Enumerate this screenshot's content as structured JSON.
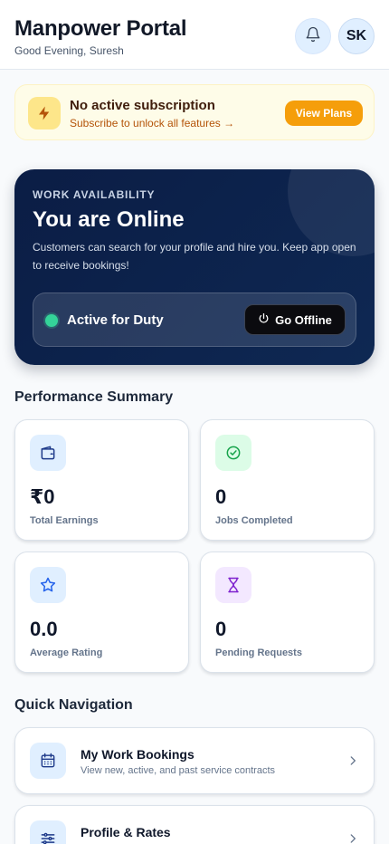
{
  "header": {
    "title": "Manpower Portal",
    "greeting": "Good Evening, Suresh",
    "avatar_initials": "SK"
  },
  "subscription": {
    "title": "No active subscription",
    "subtitle": "Subscribe to unlock all features →",
    "button_label": "View Plans"
  },
  "availability": {
    "eyebrow": "WORK AVAILABILITY",
    "title": "You are Online",
    "description": "Customers can search for your profile and hire you. Keep app open to receive bookings!",
    "duty_label": "Active for Duty",
    "toggle_label": "Go Offline"
  },
  "performance": {
    "title": "Performance Summary",
    "stats": [
      {
        "value": "₹0",
        "label": "Total Earnings",
        "icon": "wallet-icon"
      },
      {
        "value": "0",
        "label": "Jobs Completed",
        "icon": "check-badge-icon"
      },
      {
        "value": "0.0",
        "label": "Average Rating",
        "icon": "star-icon"
      },
      {
        "value": "0",
        "label": "Pending Requests",
        "icon": "hourglass-icon"
      }
    ]
  },
  "navigation": {
    "title": "Quick Navigation",
    "items": [
      {
        "title": "My Work Bookings",
        "subtitle": "View new, active, and past service contracts",
        "icon": "calendar-icon"
      },
      {
        "title": "Profile & Rates",
        "subtitle": "",
        "icon": "sliders-icon"
      }
    ]
  },
  "colors": {
    "accent": "#f59e0b",
    "card_dark": "#0b1d45",
    "online": "#34d399"
  }
}
